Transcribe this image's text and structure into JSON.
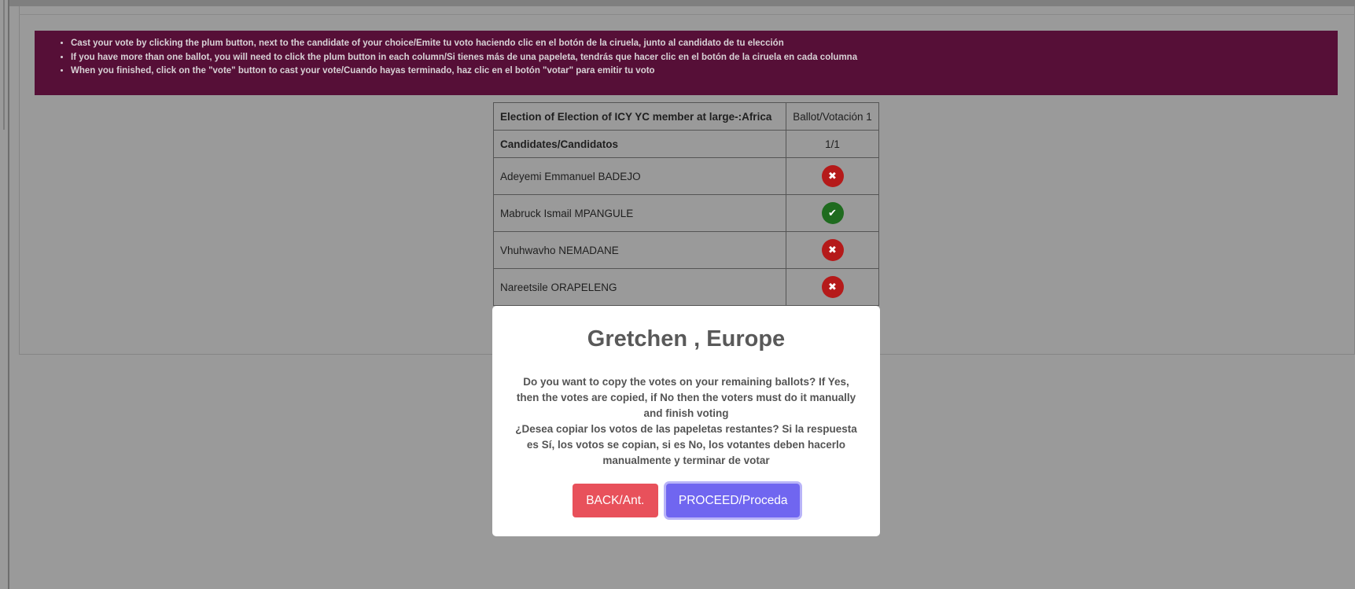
{
  "instructions": [
    "Cast your vote by clicking the plum button, next to the candidate of your choice/Emite tu voto haciendo clic en el botón de la ciruela, junto al candidato de tu elección",
    "If you have more than one ballot, you will need to click the plum button in each column/Si tienes más de una papeleta, tendrás que hacer clic en el botón de la ciruela en cada columna",
    "When you finished, click on the \"vote\" button to cast your vote/Cuando hayas terminado, haz clic en el botón \"votar\" para emitir tu voto"
  ],
  "ballot": {
    "election_title": "Election of Election of ICY YC member at large-:Africa",
    "ballot_label": "Ballot/Votación 1",
    "candidates_header": "Candidates/Candidatos",
    "selection_count": "1/1",
    "candidates": [
      {
        "name": "Adeyemi Emmanuel BADEJO",
        "selected": false,
        "glyph": "✖"
      },
      {
        "name": "Mabruck Ismail MPANGULE",
        "selected": true,
        "glyph": "✔"
      },
      {
        "name": "Vhuhwavho NEMADANE",
        "selected": false,
        "glyph": "✖"
      },
      {
        "name": "Nareetsile ORAPELENG",
        "selected": false,
        "glyph": "✖"
      }
    ]
  },
  "modal": {
    "title": "Gretchen , Europe",
    "message_en": "Do you want to copy the votes on your remaining ballots? If Yes, then the votes are copied, if No then the voters must do it manually and finish voting",
    "message_es": "¿Desea copiar los votos de las papeletas restantes? Si la respuesta es Sí, los votos se copian, si es No, los votantes deben hacerlo manualmente y terminar de votar",
    "back_label": "BACK/Ant.",
    "proceed_label": "PROCEED/Proceda"
  },
  "colors": {
    "instructions_bg": "#560f37",
    "overlay": "#9a9a9a",
    "reject_icon": "#b51a1a",
    "accept_icon": "#1f6b1f",
    "back_button": "#e8515b",
    "proceed_button": "#7066f0"
  },
  "icons": {
    "reject": "x-circle-icon",
    "accept": "check-circle-icon"
  }
}
